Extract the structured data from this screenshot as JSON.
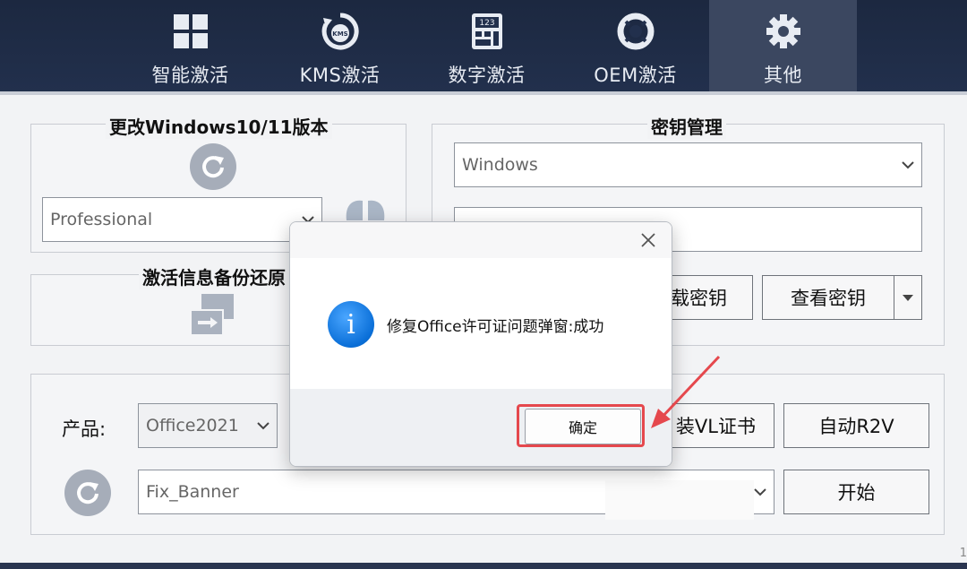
{
  "nav": {
    "tabs": [
      {
        "label": "智能激活",
        "icon": "grid-icon",
        "active": false
      },
      {
        "label": "KMS激活",
        "icon": "kms-icon",
        "active": false
      },
      {
        "label": "数字激活",
        "icon": "calculator-icon",
        "active": false
      },
      {
        "label": "OEM激活",
        "icon": "lifebuoy-icon",
        "active": false
      },
      {
        "label": "其他",
        "icon": "gear-icon",
        "active": true
      }
    ]
  },
  "edition_panel": {
    "title": "更改Windows10/11版本",
    "select_value": "Professional"
  },
  "backup_panel": {
    "title": "激活信息备份还原"
  },
  "key_panel": {
    "title": "密钥管理",
    "select_value": "Windows",
    "key_input_value": "",
    "uninstall_key_label": "载密钥",
    "view_key_label": "查看密钥"
  },
  "office_panel": {
    "product_label": "产品:",
    "product_value": "Office2021",
    "install_vl_label": "装VL证书",
    "auto_r2v_label": "自动R2V",
    "fix_select_value": "Fix_Banner",
    "start_label": "开始"
  },
  "modal": {
    "title": "",
    "message": "修复Office许可证问题弹窗:成功",
    "ok_label": "确定"
  },
  "footer": {
    "corner_text": "1"
  },
  "colors": {
    "nav_bg": "#1c2840",
    "nav_active": "#3b4760",
    "highlight": "#e5484d",
    "info_blue": "#0a6fd8"
  }
}
